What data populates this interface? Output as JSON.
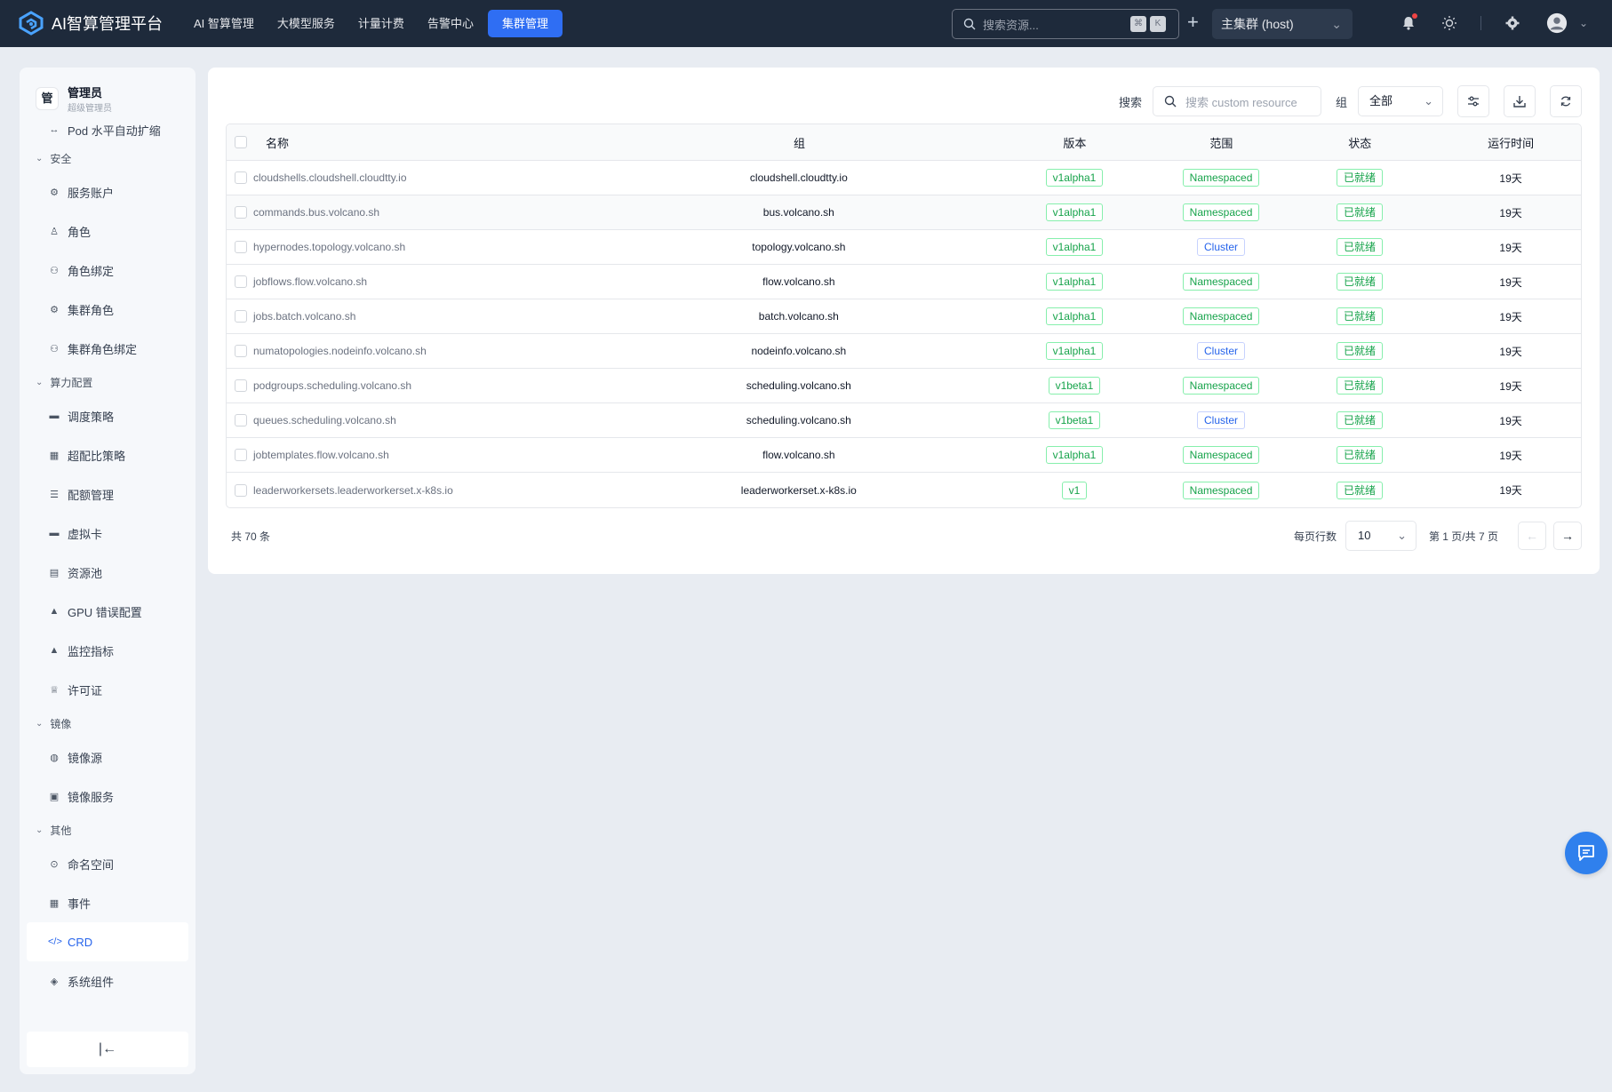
{
  "app": {
    "title": "AI智算管理平台"
  },
  "nav": [
    {
      "label": "AI 智算管理",
      "active": false
    },
    {
      "label": "大模型服务",
      "active": false
    },
    {
      "label": "计量计费",
      "active": false
    },
    {
      "label": "告警中心",
      "active": false
    },
    {
      "label": "集群管理",
      "active": true
    }
  ],
  "topbar": {
    "search_placeholder": "搜索资源...",
    "kbd1": "⌘",
    "kbd2": "K",
    "cluster": "主集群 (host)"
  },
  "user": {
    "avatar": "管",
    "name": "管理员",
    "role": "超级管理员"
  },
  "sidebar": {
    "top_item": "Pod 水平自动扩缩",
    "sections": [
      {
        "label": "安全",
        "items": [
          "服务账户",
          "角色",
          "角色绑定",
          "集群角色",
          "集群角色绑定"
        ]
      },
      {
        "label": "算力配置",
        "items": [
          "调度策略",
          "超配比策略",
          "配额管理",
          "虚拟卡",
          "资源池",
          "GPU 错误配置",
          "监控指标",
          "许可证"
        ]
      },
      {
        "label": "镜像",
        "items": [
          "镜像源",
          "镜像服务"
        ]
      },
      {
        "label": "其他",
        "items": [
          "命名空间",
          "事件",
          "CRD",
          "系统组件"
        ]
      }
    ],
    "active": "CRD",
    "collapse": "|←"
  },
  "toolbar": {
    "search_label": "搜索",
    "search_placeholder": "搜索 custom resource",
    "group_label": "组",
    "group_value": "全部"
  },
  "table": {
    "headers": [
      "名称",
      "组",
      "版本",
      "范围",
      "状态",
      "运行时间"
    ],
    "rows": [
      {
        "name": "cloudshells.cloudshell.cloudtty.io",
        "group": "cloudshell.cloudtty.io",
        "version": "v1alpha1",
        "scope": "Namespaced",
        "status": "已就绪",
        "age": "19天"
      },
      {
        "name": "commands.bus.volcano.sh",
        "group": "bus.volcano.sh",
        "version": "v1alpha1",
        "scope": "Namespaced",
        "status": "已就绪",
        "age": "19天"
      },
      {
        "name": "hypernodes.topology.volcano.sh",
        "group": "topology.volcano.sh",
        "version": "v1alpha1",
        "scope": "Cluster",
        "status": "已就绪",
        "age": "19天"
      },
      {
        "name": "jobflows.flow.volcano.sh",
        "group": "flow.volcano.sh",
        "version": "v1alpha1",
        "scope": "Namespaced",
        "status": "已就绪",
        "age": "19天"
      },
      {
        "name": "jobs.batch.volcano.sh",
        "group": "batch.volcano.sh",
        "version": "v1alpha1",
        "scope": "Namespaced",
        "status": "已就绪",
        "age": "19天"
      },
      {
        "name": "numatopologies.nodeinfo.volcano.sh",
        "group": "nodeinfo.volcano.sh",
        "version": "v1alpha1",
        "scope": "Cluster",
        "status": "已就绪",
        "age": "19天"
      },
      {
        "name": "podgroups.scheduling.volcano.sh",
        "group": "scheduling.volcano.sh",
        "version": "v1beta1",
        "scope": "Namespaced",
        "status": "已就绪",
        "age": "19天"
      },
      {
        "name": "queues.scheduling.volcano.sh",
        "group": "scheduling.volcano.sh",
        "version": "v1beta1",
        "scope": "Cluster",
        "status": "已就绪",
        "age": "19天"
      },
      {
        "name": "jobtemplates.flow.volcano.sh",
        "group": "flow.volcano.sh",
        "version": "v1alpha1",
        "scope": "Namespaced",
        "status": "已就绪",
        "age": "19天"
      },
      {
        "name": "leaderworkersets.leaderworkerset.x-k8s.io",
        "group": "leaderworkerset.x-k8s.io",
        "version": "v1",
        "scope": "Namespaced",
        "status": "已就绪",
        "age": "19天"
      }
    ]
  },
  "footer": {
    "total": "共 70 条",
    "rows_per_page_label": "每页行数",
    "rows_per_page": "10",
    "page_info": "第 1 页/共 7 页",
    "prev": "←",
    "next": "→"
  },
  "colors": {
    "accent": "#2f6ef3",
    "topbar": "#1e2a3b",
    "success": "#16a34a",
    "link_blue": "#2563eb"
  }
}
